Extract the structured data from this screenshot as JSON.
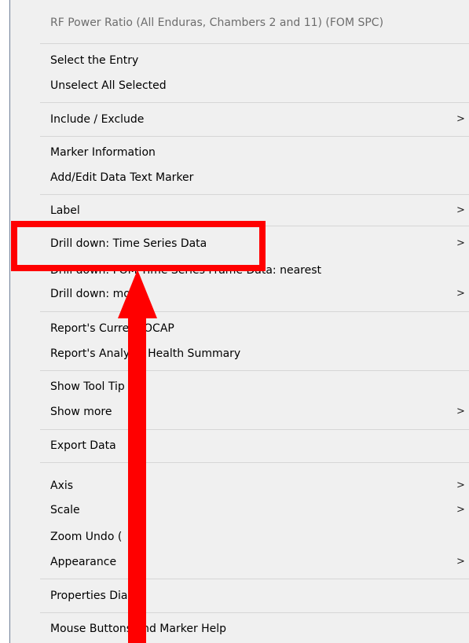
{
  "menu": {
    "title": "RF Power Ratio (All Enduras, Chambers 2 and 11) (FOM SPC)",
    "items": [
      {
        "label": "Select the Entry",
        "submenu": false
      },
      {
        "label": "Unselect All Selected",
        "submenu": false
      },
      {
        "label": "Include / Exclude",
        "submenu": true
      },
      {
        "label": "Marker Information",
        "submenu": false
      },
      {
        "label": "Add/Edit Data Text Marker",
        "submenu": false
      },
      {
        "label": "Label",
        "submenu": true
      },
      {
        "label": "Drill down: Time Series Data",
        "submenu": true
      },
      {
        "label": "Drill down: FOM Time Series Frame Data: nearest",
        "submenu": false
      },
      {
        "label": "Drill down: more",
        "submenu": true
      },
      {
        "label": "Report's Current OCAP",
        "submenu": false
      },
      {
        "label": "Report's Analysis Health Summary",
        "submenu": false
      },
      {
        "label": "Show Tool Tip",
        "submenu": false
      },
      {
        "label": "Show more",
        "submenu": true
      },
      {
        "label": "Export Data",
        "submenu": false
      },
      {
        "label": "Axis",
        "submenu": true
      },
      {
        "label": "Scale",
        "submenu": true
      },
      {
        "label": "Zoom Undo (",
        "submenu": false
      },
      {
        "label": "Appearance",
        "submenu": true
      },
      {
        "label": "Properties Dialog",
        "submenu": false
      },
      {
        "label": "Mouse Buttons and Marker Help",
        "submenu": false
      }
    ],
    "submenu_arrow": ">"
  },
  "annotation": {
    "color": "#ff0000",
    "target": "Drill down: Time Series Data"
  }
}
